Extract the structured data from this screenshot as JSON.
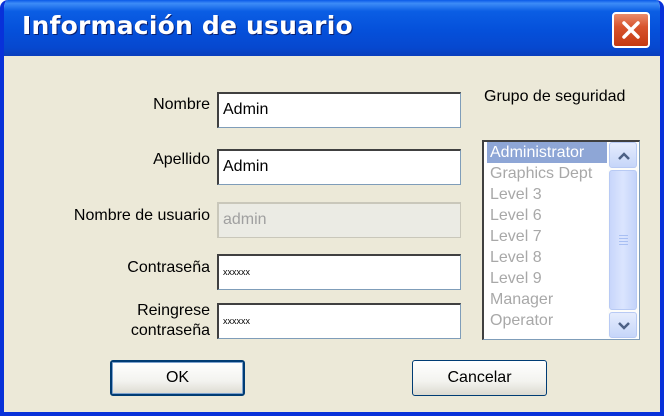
{
  "window": {
    "title": "Información de usuario"
  },
  "form": {
    "nombre": {
      "label": "Nombre",
      "value": "Admin"
    },
    "apellido": {
      "label": "Apellido",
      "value": "Admin"
    },
    "usuario": {
      "label": "Nombre de usuario",
      "value": "admin"
    },
    "contrasena": {
      "label": "Contraseña",
      "value": "xxxxxx"
    },
    "reingrese": {
      "label_line1": "Reingrese",
      "label_line2": "contraseña",
      "value": "xxxxxx"
    }
  },
  "security_group": {
    "label": "Grupo de seguridad",
    "items": [
      "Administrator",
      "Graphics Dept",
      "Level 3",
      "Level 6",
      "Level 7",
      "Level 8",
      "Level 9",
      "Manager",
      "Operator"
    ],
    "selected": "Administrator"
  },
  "buttons": {
    "ok": "OK",
    "cancel": "Cancelar"
  },
  "icons": {
    "close": "close-icon",
    "scroll_up": "chevron-up-icon",
    "scroll_down": "chevron-down-icon"
  }
}
